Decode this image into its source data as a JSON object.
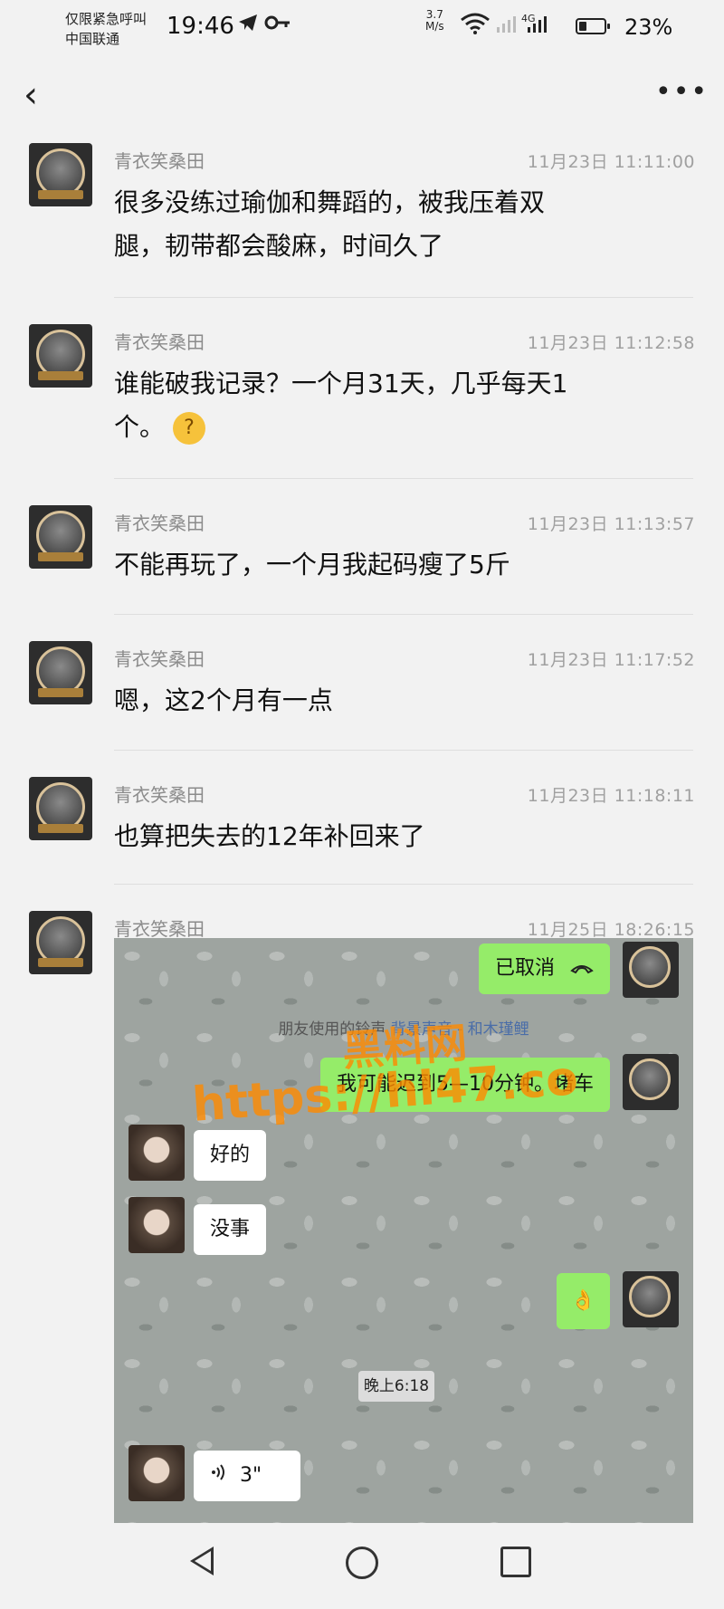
{
  "status_bar": {
    "carrier_line1": "仅限紧急呼叫",
    "carrier_line2": "中国联通",
    "time": "19:46",
    "icons": [
      "telegram-icon",
      "key-icon",
      "wifi-icon",
      "signal-icon",
      "battery-icon"
    ],
    "net_speed_value": "3.7",
    "net_speed_unit": "M/s",
    "net_type": "4G",
    "battery_percent": "23%"
  },
  "nav": {
    "back_icon": "back-chevron-icon",
    "more_icon": "more-dots-icon",
    "back_glyph": "‹",
    "more_glyph": "•••"
  },
  "messages": [
    {
      "sender": "青衣笑桑田",
      "time": "11月23日 11:11:00",
      "text_lines": [
        "很多没练过瑜伽和舞蹈的，被我压着双",
        "腿，韧带都会酸麻，时间久了"
      ]
    },
    {
      "sender": "青衣笑桑田",
      "time": "11月23日 11:12:58",
      "text_lines": [
        "谁能破我记录？一个月31天，几乎每天1",
        "个。"
      ],
      "emoji": "thinking-emoji"
    },
    {
      "sender": "青衣笑桑田",
      "time": "11月23日 11:13:57",
      "text_lines": [
        "不能再玩了，一个月我起码瘦了5斤"
      ]
    },
    {
      "sender": "青衣笑桑田",
      "time": "11月23日 11:17:52",
      "text_lines": [
        "嗯，这2个月有一点"
      ]
    },
    {
      "sender": "青衣笑桑田",
      "time": "11月23日 11:18:11",
      "text_lines": [
        "也算把失去的12年补回来了"
      ]
    },
    {
      "sender": "青衣笑桑田",
      "time": "11月25日 18:26:15",
      "text_lines": []
    }
  ],
  "embedded_chat": {
    "call_cancelled": "已取消",
    "ringtone_prefix": "朋友使用的铃声",
    "ringtone_song": "背景声音 - 和木瑾鲤",
    "late_msg": "我可能迟到5—10分钟。堵车",
    "reply1": "好的",
    "reply2": "没事",
    "ok_emoji": "👌",
    "time_divider": "晚上6:18",
    "voice_duration": "3\""
  },
  "watermark": {
    "line1": "黑料网",
    "line2": "https://hl47.co"
  },
  "colors": {
    "green_bubble": "#95ec69",
    "watermark": "#ff8a00"
  }
}
